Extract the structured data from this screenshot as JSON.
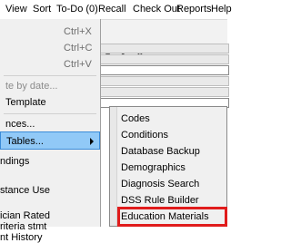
{
  "menubar": {
    "items": [
      "View",
      "Sort",
      "To-Do (0)",
      "Recall",
      "Check Out",
      "Reports",
      "Help"
    ]
  },
  "view_menu": {
    "items": [
      {
        "label": "",
        "shortcut": "Ctrl+X"
      },
      {
        "label": "",
        "shortcut": "Ctrl+C"
      },
      {
        "label": "",
        "shortcut": "Ctrl+V"
      },
      {
        "label": "te by date..."
      },
      {
        "label": "Template"
      },
      {
        "label": "nces..."
      },
      {
        "label": "Tables..."
      }
    ]
  },
  "background_list": [
    "ndings",
    "stance Use",
    "ician Rated",
    "riteria stmt",
    "nt History"
  ],
  "tables_submenu": {
    "items": [
      "Codes",
      "Conditions",
      "Database Backup",
      "Demographics",
      "Diagnosis Search",
      "DSS Rule Builder",
      "Education Materials"
    ]
  },
  "colors": {
    "highlight": "#91c9f7",
    "callout": "#e01c1c"
  }
}
